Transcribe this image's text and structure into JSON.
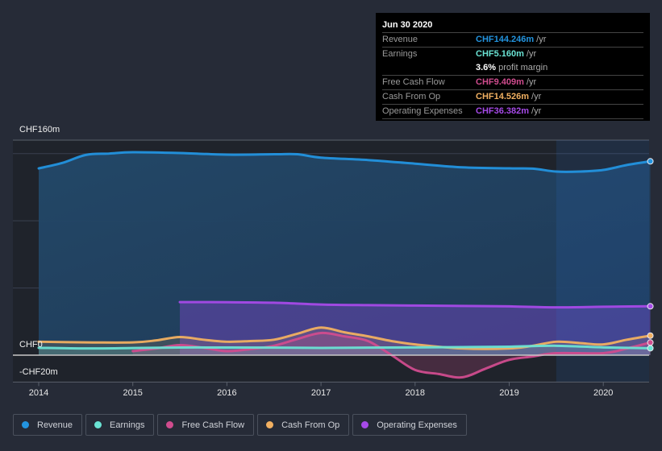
{
  "tooltip": {
    "date": "Jun 30 2020",
    "rows": [
      {
        "label": "Revenue",
        "value": "CHF144.246m",
        "unit": "/yr",
        "color": "#2394df"
      },
      {
        "label": "Earnings",
        "value": "CHF5.160m",
        "unit": "/yr",
        "color": "#6ae3d4"
      },
      {
        "label": "",
        "value": "3.6%",
        "unit": "profit margin",
        "color": "#ffffff"
      },
      {
        "label": "Free Cash Flow",
        "value": "CHF9.409m",
        "unit": "/yr",
        "color": "#d04c8e"
      },
      {
        "label": "Cash From Op",
        "value": "CHF14.526m",
        "unit": "/yr",
        "color": "#f1b061"
      },
      {
        "label": "Operating Expenses",
        "value": "CHF36.382m",
        "unit": "/yr",
        "color": "#a64ae8"
      }
    ]
  },
  "legend": [
    {
      "label": "Revenue",
      "color": "#2394df"
    },
    {
      "label": "Earnings",
      "color": "#6ae3d4"
    },
    {
      "label": "Free Cash Flow",
      "color": "#d04c8e"
    },
    {
      "label": "Cash From Op",
      "color": "#f1b061"
    },
    {
      "label": "Operating Expenses",
      "color": "#a64ae8"
    }
  ],
  "chart_data": {
    "type": "area",
    "title": "",
    "xlabel": "",
    "ylabel": "",
    "currency_unit": "CHF m",
    "y_tick_labels": [
      "CHF160m",
      "CHF0",
      "-CHF20m"
    ],
    "y_ticks": [
      160,
      0,
      -20
    ],
    "ylim": [
      -20,
      160
    ],
    "x_tick_labels": [
      "2014",
      "2015",
      "2016",
      "2017",
      "2018",
      "2019",
      "2020"
    ],
    "x_ticks": [
      2014,
      2015,
      2016,
      2017,
      2018,
      2019,
      2020
    ],
    "xlim": [
      2013.72,
      2020.5
    ],
    "highlight_range": [
      2019.5,
      2020.5
    ],
    "grid": true,
    "legend_position": "bottom-left",
    "series": [
      {
        "name": "Revenue",
        "color": "#2394df",
        "x": [
          2014.0,
          2014.25,
          2014.5,
          2014.75,
          2015.0,
          2015.5,
          2016.0,
          2016.5,
          2016.75,
          2017.0,
          2017.5,
          2018.0,
          2018.5,
          2019.0,
          2019.25,
          2019.5,
          2019.75,
          2020.0,
          2020.25,
          2020.5
        ],
        "y": [
          139.0,
          143.0,
          149.0,
          150.0,
          151.0,
          150.4,
          149.2,
          149.5,
          149.5,
          147.0,
          145.2,
          142.5,
          139.8,
          139.0,
          138.8,
          136.6,
          136.6,
          137.8,
          141.5,
          144.246
        ]
      },
      {
        "name": "Earnings",
        "color": "#6ae3d4",
        "x": [
          2014.0,
          2014.5,
          2015.0,
          2015.5,
          2016.0,
          2016.5,
          2017.0,
          2017.5,
          2018.0,
          2018.5,
          2019.0,
          2019.5,
          2020.0,
          2020.5
        ],
        "y": [
          5.5,
          5.0,
          5.3,
          5.7,
          5.7,
          5.6,
          5.4,
          5.6,
          5.8,
          6.0,
          6.3,
          7.0,
          5.8,
          5.16
        ]
      },
      {
        "name": "Free Cash Flow",
        "color": "#d04c8e",
        "x": [
          2015.0,
          2015.25,
          2015.5,
          2015.75,
          2016.0,
          2016.25,
          2016.5,
          2016.75,
          2017.0,
          2017.25,
          2017.5,
          2017.75,
          2018.0,
          2018.25,
          2018.5,
          2018.75,
          2019.0,
          2019.25,
          2019.5,
          2020.0,
          2020.25,
          2020.5
        ],
        "y": [
          3.0,
          5.0,
          7.5,
          5.5,
          3.0,
          4.5,
          7.0,
          12.0,
          16.5,
          14.0,
          10.5,
          0.0,
          -11.0,
          -14.0,
          -16.5,
          -10.0,
          -3.5,
          -1.0,
          1.5,
          1.5,
          5.0,
          9.409
        ]
      },
      {
        "name": "Cash From Op",
        "color": "#f1b061",
        "x": [
          2014.0,
          2014.5,
          2015.0,
          2015.25,
          2015.5,
          2015.75,
          2016.0,
          2016.25,
          2016.5,
          2016.75,
          2017.0,
          2017.25,
          2017.5,
          2017.75,
          2018.0,
          2018.5,
          2019.0,
          2019.25,
          2019.5,
          2019.75,
          2020.0,
          2020.25,
          2020.5
        ],
        "y": [
          10.0,
          9.5,
          9.5,
          11.0,
          13.5,
          11.5,
          10.0,
          10.5,
          11.5,
          16.0,
          20.5,
          17.0,
          14.0,
          10.5,
          8.0,
          5.0,
          5.0,
          7.0,
          10.0,
          9.0,
          8.0,
          11.5,
          14.526
        ]
      },
      {
        "name": "Operating Expenses",
        "color": "#a64ae8",
        "x": [
          2015.5,
          2016.0,
          2016.5,
          2017.0,
          2017.5,
          2018.0,
          2018.5,
          2019.0,
          2019.5,
          2020.0,
          2020.5
        ],
        "y": [
          39.5,
          39.4,
          39.0,
          37.7,
          37.2,
          36.9,
          36.6,
          36.3,
          35.6,
          36.0,
          36.382
        ]
      }
    ]
  }
}
